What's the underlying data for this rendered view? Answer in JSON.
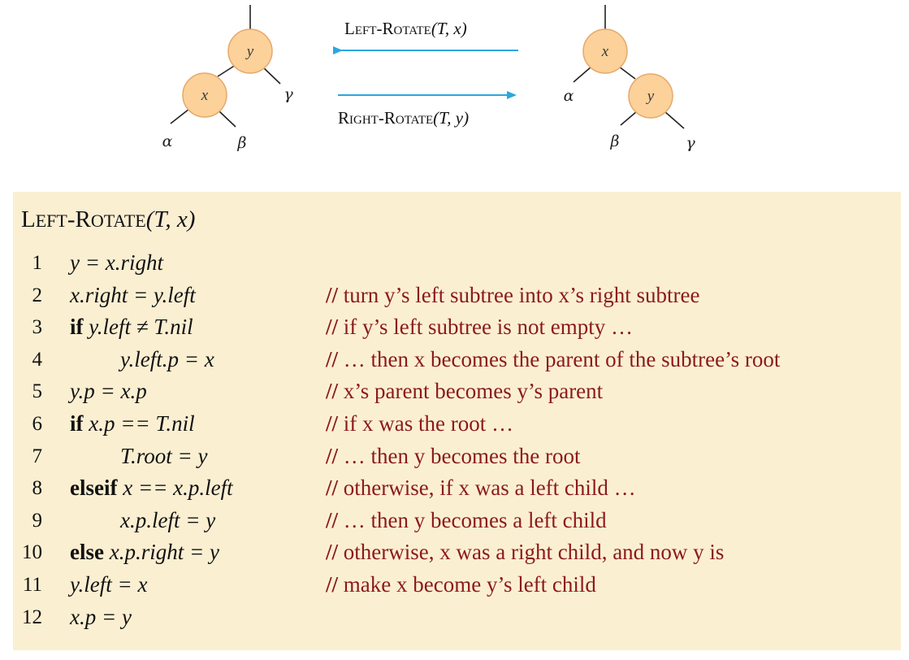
{
  "diagram": {
    "left_tree": {
      "root": "y",
      "child": "x",
      "leaves": [
        "α",
        "β",
        "γ"
      ]
    },
    "right_tree": {
      "root": "x",
      "child": "y",
      "leaves": [
        "α",
        "β",
        "γ"
      ]
    },
    "arrow_left_label": {
      "first": "L",
      "rest": "EFT",
      "dash": "-",
      "first2": "R",
      "rest2": "OTATE",
      "args": "(T, x)"
    },
    "arrow_right_label": {
      "first": "R",
      "rest": "IGHT",
      "dash": "-",
      "first2": "R",
      "rest2": "OTATE",
      "args": "(T, y)"
    },
    "colors": {
      "node_fill": "#fcd19a",
      "node_stroke": "#e6a96a",
      "arrow": "#2aa7df",
      "edge": "#222222"
    }
  },
  "procedure": {
    "name_first": "L",
    "name_rest": "EFT",
    "name_dash": "-",
    "name_first2": "R",
    "name_rest2": "OTATE",
    "args": "(T, x)",
    "lines": [
      {
        "num": "1",
        "kw": "",
        "code": "y = x.right",
        "comment_pre": "",
        "comment": ""
      },
      {
        "num": "2",
        "kw": "",
        "code": "x.right = y.left",
        "comment": "turn y’s left subtree into x’s right subtree"
      },
      {
        "num": "3",
        "kw": "if",
        "code": "y.left ≠ T.nil",
        "comment": "if y’s left subtree is not empty …"
      },
      {
        "num": "4",
        "kw": "",
        "code": "y.left.p = x",
        "comment": "… then x becomes the parent of the subtree’s root"
      },
      {
        "num": "5",
        "kw": "",
        "code": "y.p = x.p",
        "comment": "x’s parent becomes y’s parent"
      },
      {
        "num": "6",
        "kw": "if",
        "code": "x.p == T.nil",
        "comment": "if x was the root …"
      },
      {
        "num": "7",
        "kw": "",
        "code": "T.root = y",
        "comment": "… then y becomes the root"
      },
      {
        "num": "8",
        "kw": "elseif",
        "code": "x == x.p.left",
        "comment": "otherwise, if x was a left child …"
      },
      {
        "num": "9",
        "kw": "",
        "code": "x.p.left = y",
        "comment": "… then y becomes a left child"
      },
      {
        "num": "10",
        "kw": "else",
        "code": "x.p.right = y",
        "comment": "otherwise, x was a right child, and now y is"
      },
      {
        "num": "11",
        "kw": "",
        "code": "y.left = x",
        "comment": "make x become y’s left child"
      },
      {
        "num": "12",
        "kw": "",
        "code": "x.p = y",
        "comment": ""
      }
    ],
    "comment_marker": "//",
    "panel_color": "#fbefd2",
    "comment_color": "#8b1a1a"
  }
}
